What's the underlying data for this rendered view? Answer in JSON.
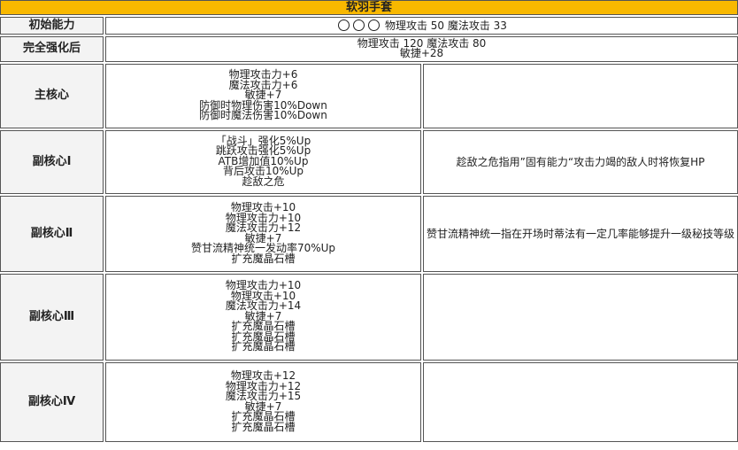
{
  "title": "软羽手套",
  "rows": {
    "initial": {
      "label": "初始能力",
      "value": "物理攻击 50 魔法攻击 33"
    },
    "full": {
      "label": "完全强化后",
      "lines": [
        "物理攻击 120 魔法攻击 80",
        "敏捷+28"
      ]
    },
    "core_main": {
      "label": "主核心",
      "lines": [
        "物理攻击力+6",
        "魔法攻击力+6",
        "敏捷+7",
        "防御时物理伤害10%Down",
        "防御时魔法伤害10%Down"
      ],
      "desc": ""
    },
    "core_1": {
      "label": "副核心Ⅰ",
      "lines": [
        "「战斗」强化5%Up",
        "跳跃攻击强化5%Up",
        "ATB增加值10%Up",
        "背后攻击10%Up",
        "趁敌之危"
      ],
      "desc": "趁敌之危指用”固有能力“攻击力竭的敌人时将恢复HP"
    },
    "core_2": {
      "label": "副核心Ⅱ",
      "lines": [
        "物理攻击+10",
        "物理攻击力+10",
        "魔法攻击力+12",
        "敏捷+7",
        "赞甘流精神统一发动率70%Up",
        "扩充魔晶石槽"
      ],
      "desc": "赞甘流精神统一指在开场时蒂法有一定几率能够提升一级秘技等级"
    },
    "core_3": {
      "label": "副核心Ⅲ",
      "lines": [
        "物理攻击力+10",
        "物理攻击+10",
        "魔法攻击力+14",
        "敏捷+7",
        "扩充魔晶石槽",
        "扩充魔晶石槽",
        "扩充魔晶石槽"
      ],
      "desc": ""
    },
    "core_4": {
      "label": "副核心Ⅳ",
      "lines": [
        "物理攻击+12",
        "物理攻击力+12",
        "魔法攻击力+15",
        "敏捷+7",
        "扩充魔晶石槽",
        "扩充魔晶石槽"
      ],
      "desc": ""
    }
  }
}
